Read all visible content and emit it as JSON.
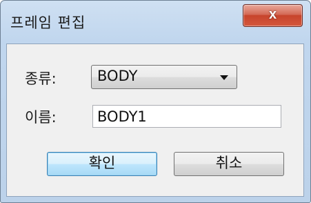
{
  "dialog": {
    "title": "프레임 편집",
    "close_label": "x"
  },
  "form": {
    "type_label": "종류:",
    "type_value": "BODY",
    "name_label": "이름:",
    "name_value": "BODY1"
  },
  "buttons": {
    "ok_label": "확인",
    "cancel_label": "취소"
  }
}
